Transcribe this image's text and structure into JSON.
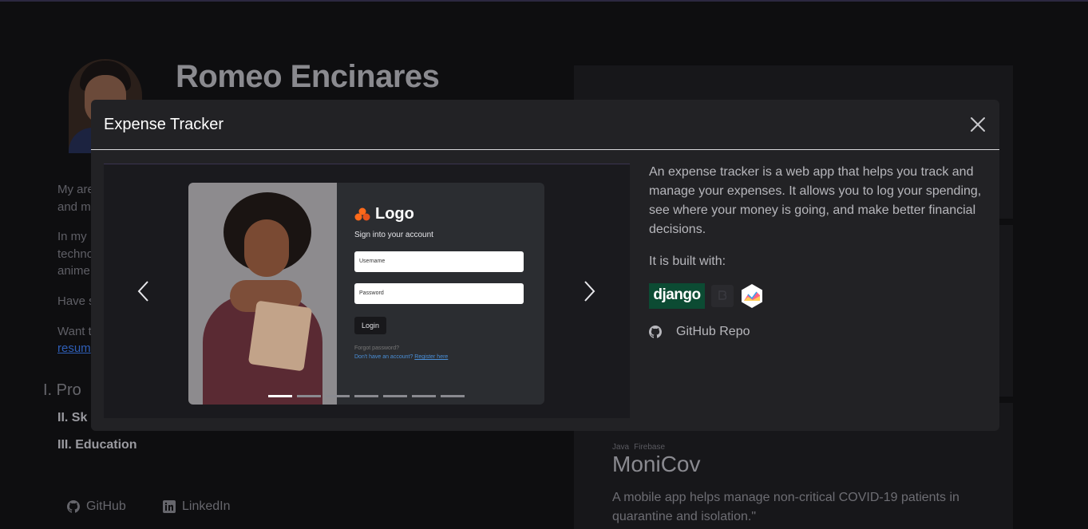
{
  "profile": {
    "name": "Romeo Encinares",
    "bio_lines": [
      "My are",
      "and m",
      "In my",
      "techno",
      "anime",
      "Have s",
      "Want t"
    ],
    "resume_link": "resum"
  },
  "sections": {
    "s1": "I.   Pro",
    "s2": "II.  Sk",
    "s3": "III.  Education"
  },
  "footer": {
    "github": "GitHub",
    "linkedin": "LinkedIn"
  },
  "project_card": {
    "tags": [
      "Java",
      "Firebase"
    ],
    "title": "MoniCov",
    "description": "A mobile app helps manage non-critical COVID-19 patients in quarantine and isolation.\""
  },
  "modal": {
    "title": "Expense Tracker",
    "description": "An expense tracker is a web app that helps you track and manage your expenses. It allows you to log your spending, see where your money is going, and make better financial decisions.",
    "built_with_label": "It is built with:",
    "badges": [
      "django"
    ],
    "repo_label": "GitHub Repo",
    "carousel": {
      "slide_count": 7,
      "active_index": 0,
      "slide": {
        "logo": "Logo",
        "subtitle": "Sign into your account",
        "username_placeholder": "Username",
        "password_placeholder": "Password",
        "login_button": "Login",
        "forgot": "Forgot password?",
        "register_prompt": "Don't have an account?",
        "register_link": "Register here"
      }
    }
  },
  "colors": {
    "accent_django": "#0c4b33",
    "link": "#4a8fd8",
    "logo_orange": "#ff6a1a"
  }
}
